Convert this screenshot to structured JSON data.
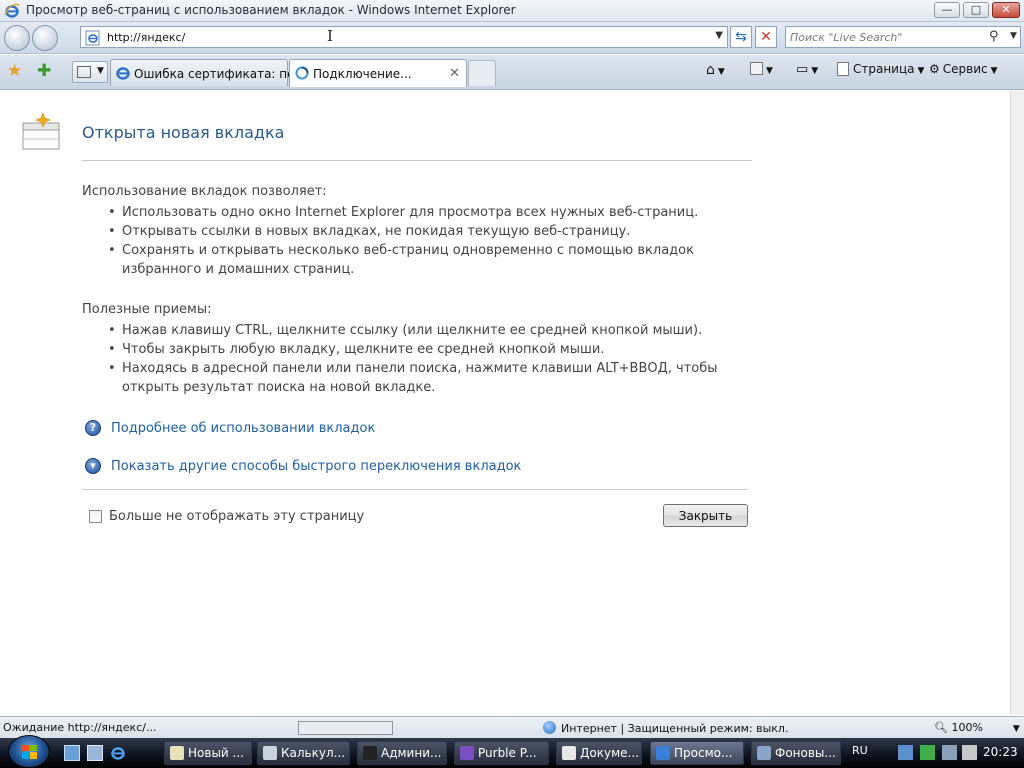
{
  "window": {
    "title": "Просмотр веб-страниц с использованием вкладок - Windows Internet Explorer",
    "minimize_label": "—",
    "maximize_label": "□",
    "close_label": "✕"
  },
  "navbar": {
    "url": "http://яндекс/",
    "search_placeholder": "Поиск \"Live Search\""
  },
  "tabs": [
    {
      "label": "Ошибка сертификата: пе...",
      "active": false
    },
    {
      "label": "Подключение...",
      "active": true
    }
  ],
  "command_bar": {
    "page_label": "Страница",
    "tools_label": "Сервис"
  },
  "content": {
    "title": "Открыта новая вкладка",
    "section1_head": "Использование вкладок позволяет:",
    "section1_items": [
      "Использовать одно окно Internet Explorer для просмотра всех нужных веб-страниц.",
      "Открывать ссылки в новых вкладках, не покидая текущую веб-страницу.",
      "Сохранять и открывать несколько веб-страниц одновременно с помощью вкладок избранного и домашних страниц."
    ],
    "section2_head": "Полезные приемы:",
    "section2_items": [
      "Нажав клавишу CTRL, щелкните ссылку (или щелкните ее средней кнопкой мыши).",
      "Чтобы закрыть любую вкладку, щелкните ее средней кнопкой мыши.",
      "Находясь в адресной панели или панели поиска, нажмите клавиши ALT+ВВОД, чтобы открыть результат поиска на новой вкладке."
    ],
    "link_more": "Подробнее об использовании вкладок",
    "link_show": "Показать другие способы быстрого переключения вкладок",
    "help_glyph": "?",
    "expand_glyph": "▾",
    "checkbox_label": "Больше не отображать эту страницу",
    "close_button": "Закрыть"
  },
  "statusbar": {
    "status_text": "Ожидание http://яндекс/...",
    "zone_text": "Интернет | Защищенный режим: выкл.",
    "zoom": "100%",
    "progress_fraction": 0.0
  },
  "taskbar": {
    "items": [
      {
        "label": "Новый ...",
        "icon_color": "#e8e2b8",
        "active": false
      },
      {
        "label": "Калькул...",
        "icon_color": "#c9d3de",
        "active": false
      },
      {
        "label": "Админи...",
        "icon_color": "#222222",
        "active": false
      },
      {
        "label": "Purble P...",
        "icon_color": "#7a4fbf",
        "active": false
      },
      {
        "label": "Докуме...",
        "icon_color": "#e8e8e8",
        "active": false
      },
      {
        "label": "Просмо...",
        "icon_color": "#3b7fd6",
        "active": true
      },
      {
        "label": "Фоновы...",
        "icon_color": "#8aa4c8",
        "active": false
      }
    ],
    "language": "RU",
    "clock": "20:23"
  },
  "colors": {
    "link": "#1f5fa3",
    "title": "#2a5a8c",
    "taskbar": "#0e1420"
  }
}
